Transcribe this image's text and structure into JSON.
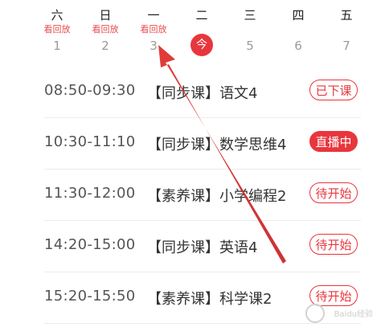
{
  "week": [
    {
      "weekday": "六",
      "replay": "看回放",
      "date": "1"
    },
    {
      "weekday": "日",
      "replay": "看回放",
      "date": "2"
    },
    {
      "weekday": "一",
      "replay": "看回放",
      "date": "3"
    },
    {
      "weekday": "二",
      "replay": "",
      "date": "今",
      "today": true
    },
    {
      "weekday": "三",
      "replay": "",
      "date": "5"
    },
    {
      "weekday": "四",
      "replay": "",
      "date": "6"
    },
    {
      "weekday": "五",
      "replay": "",
      "date": "7"
    }
  ],
  "schedule": [
    {
      "time": "08:50-09:30",
      "title": "【同步课】语文4",
      "status": "已下课"
    },
    {
      "time": "10:30-11:10",
      "title": "【同步课】数学思维4",
      "status": "直播中"
    },
    {
      "time": "11:30-12:00",
      "title": "【素养课】小学编程2",
      "status": "待开始"
    },
    {
      "time": "14:20-15:00",
      "title": "【同步课】英语4",
      "status": "待开始"
    },
    {
      "time": "15:20-15:50",
      "title": "【素养课】科学课2",
      "status": "待开始"
    }
  ],
  "watermark": "Baidu经验",
  "colors": {
    "accent": "#e8363d",
    "replay": "#e94b4f",
    "annotation_arrow": "#d8302d"
  },
  "icons": {
    "annotation": "arrow-up-left-icon",
    "logo": "baidu-paw-icon"
  }
}
